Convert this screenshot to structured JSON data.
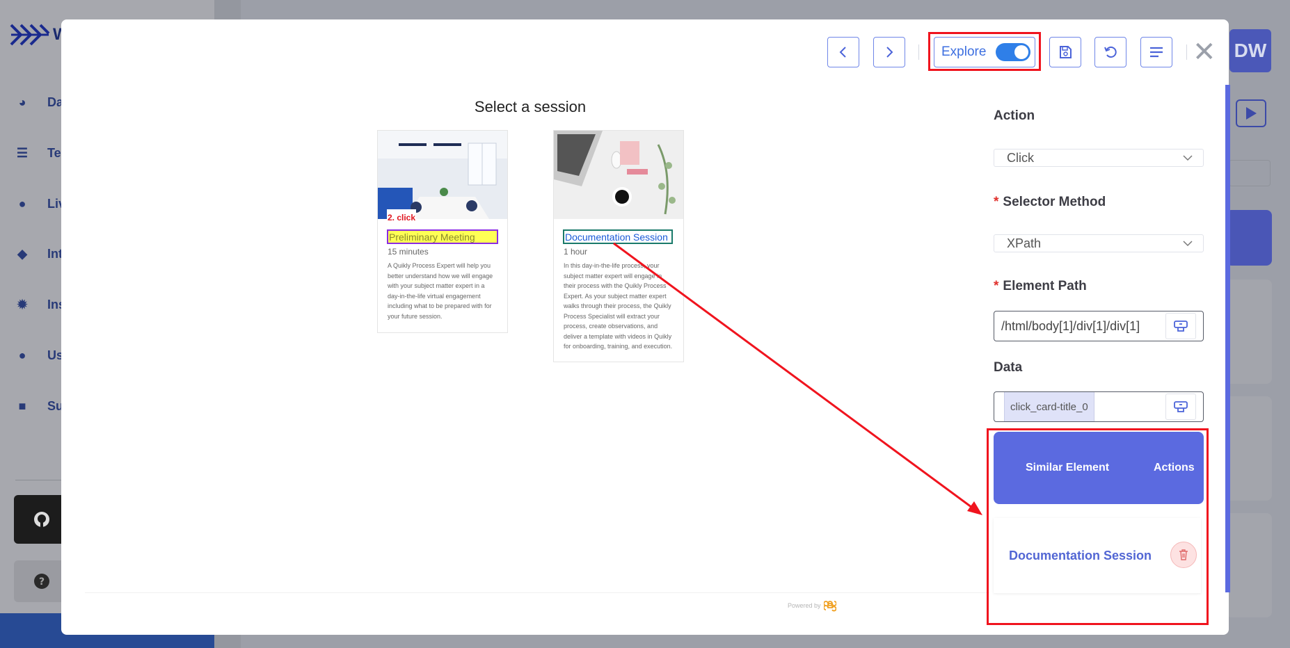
{
  "background": {
    "logo_letter": "W",
    "nav_items": [
      "Da",
      "Tes",
      "Liv",
      "Int",
      "Ins",
      "Use",
      "Sul"
    ],
    "avatar_initials": "DW"
  },
  "toolbar": {
    "explore_label": "Explore",
    "explore_on": true
  },
  "session_page": {
    "title": "Select a session",
    "click_annotation": "2. click",
    "cards": [
      {
        "title": "Preliminary Meeting",
        "duration": "15 minutes",
        "description": "A Quikly Process Expert will help you better understand how we will engage with your subject matter expert in a day-in-the-life virtual engagement including what to be prepared with for your future session."
      },
      {
        "title": "Documentation Session",
        "duration": "1 hour",
        "description": "In this day-in-the-life process, your subject matter expert will engage in their process with the Quikly Process Expert. As your subject matter expert walks through their process, the Quikly Process Specialist will extract your process, create observations, and deliver a template with videos in Quikly for onboarding, training, and execution."
      }
    ],
    "powered_by": "Powered by"
  },
  "panel": {
    "action_label": "Action",
    "action_value": "Click",
    "selector_label": "Selector Method",
    "selector_value": "XPath",
    "path_label": "Element Path",
    "path_value": "/html/body[1]/div[1]/div[1]",
    "data_label": "Data",
    "data_tag": "click_card-title_0",
    "similar_header": "Similar Element",
    "actions_header": "Actions",
    "similar_items": [
      "Documentation Session"
    ]
  },
  "colors": {
    "accent": "#5b6ae0",
    "highlight_red": "#f0141e",
    "toggle_blue": "#2f7fe8"
  }
}
